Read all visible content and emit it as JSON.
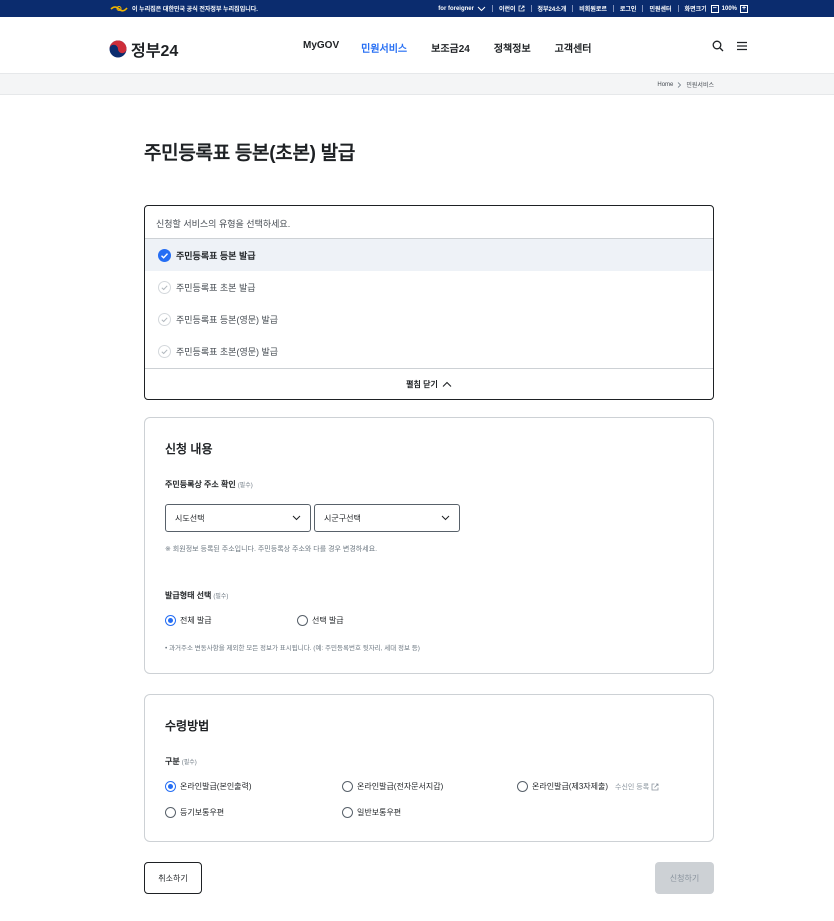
{
  "topbar": {
    "notice": "이 누리집은 대한민국 공식 전자정부 누리집입니다.",
    "links": [
      "for foreigner",
      "이런이",
      "정부24소개",
      "비회원로르",
      "로그인",
      "민원센터",
      "화면크기"
    ],
    "zoom": "100%",
    "zoom_minus": "−",
    "zoom_plus": "+"
  },
  "header": {
    "logo": "정부24",
    "nav": [
      "MyGOV",
      "민원서비스",
      "보조금24",
      "정책정보",
      "고객센터"
    ],
    "active_nav": "민원서비스",
    "accent_color": "#256ef4"
  },
  "breadcrumb": [
    "Home",
    "민원서비스"
  ],
  "page_title": "주민등록표 등본(초본) 발급",
  "service_select": {
    "placeholder": "신청할 서비스의 유형을 선택하세요.",
    "options": [
      {
        "label": "주민등록표 등본 발급",
        "selected": true
      },
      {
        "label": "주민등록표 초본 발급",
        "selected": false
      },
      {
        "label": "주민등록표 등본(영문) 발급",
        "selected": false
      },
      {
        "label": "주민등록표 초본(영문) 발급",
        "selected": false
      }
    ],
    "collapse_label": "펼침 닫기"
  },
  "application": {
    "title": "신청 내용",
    "address_label": "주민등록상 주소 확인",
    "required": "(필수)",
    "sido_select": "시도선택",
    "sigungu_select": "시군구선택",
    "address_note": "※ 회원정보 등록된 주소입니다. 주민등록상 주소와 다를 경우 변경하세요.",
    "issue_type_label": "발급형태 선택",
    "issue_options": [
      {
        "label": "전체 발급",
        "checked": true
      },
      {
        "label": "선택 발급",
        "checked": false
      }
    ],
    "issue_note": "• 과거주소 변동사항을 제외한 모든 정보가 표시됩니다. (예: 주민등록번호 뒷자리, 세대 정보 등)"
  },
  "receive": {
    "title": "수령방법",
    "category_label": "구분",
    "required": "(필수)",
    "options": [
      {
        "label": "온라인발급(본인출력)",
        "checked": true
      },
      {
        "label": "온라인발급(전자문서지갑)",
        "checked": false
      },
      {
        "label": "온라인발급(제3자제출)",
        "checked": false,
        "extra": "수신인 등록"
      },
      {
        "label": "등기보통우편",
        "checked": false
      },
      {
        "label": "일반보통우편",
        "checked": false
      }
    ]
  },
  "actions": {
    "cancel": "취소하기",
    "apply": "신청하기"
  }
}
